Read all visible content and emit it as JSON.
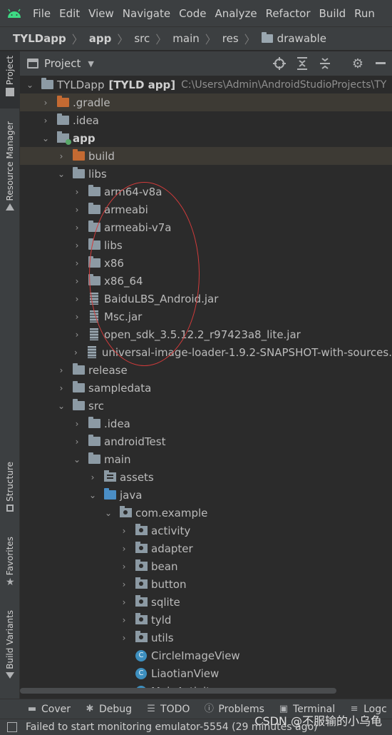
{
  "menu": {
    "items": [
      "File",
      "Edit",
      "View",
      "Navigate",
      "Code",
      "Analyze",
      "Refactor",
      "Build",
      "Run"
    ]
  },
  "breadcrumb": {
    "items": [
      "TYLDapp",
      "app",
      "src",
      "main",
      "res",
      "drawable"
    ]
  },
  "tool_window": {
    "title": "Project"
  },
  "left_tabs": {
    "project": "Project",
    "resource_manager": "Resource Manager",
    "structure": "Structure",
    "favorites": "Favorites",
    "build_variants": "Build Variants"
  },
  "tree": {
    "root_name": "TYLDapp",
    "root_module": "[TYLD app]",
    "root_path": "C:\\Users\\Admin\\AndroidStudioProjects\\TY",
    "gradle": ".gradle",
    "idea": ".idea",
    "app": "app",
    "build": "build",
    "libs": "libs",
    "libs_children": [
      "arm64-v8a",
      "armeabi",
      "armeabi-v7a",
      "libs",
      "x86",
      "x86_64"
    ],
    "jars": [
      "BaiduLBS_Android.jar",
      "Msc.jar",
      "open_sdk_3.5.12.2_r97423a8_lite.jar",
      "universal-image-loader-1.9.2-SNAPSHOT-with-sources."
    ],
    "release": "release",
    "sampledata": "sampledata",
    "src": "src",
    "src_idea": ".idea",
    "android_test": "androidTest",
    "main": "main",
    "assets": "assets",
    "java": "java",
    "com_example": "com.example",
    "packages": [
      "activity",
      "adapter",
      "bean",
      "button",
      "sqlite",
      "tyld",
      "utils"
    ],
    "classes": [
      "CircleImageView",
      "LiaotianView",
      "MainActivity"
    ]
  },
  "bottom_tools": {
    "cover": "Cover",
    "debug": "Debug",
    "todo": "TODO",
    "problems": "Problems",
    "terminal": "Terminal",
    "logcat": "Logc"
  },
  "status": {
    "message": "Failed to start monitoring emulator-5554 (29 minutes ago)"
  },
  "watermark": "CSDN @不服输的小乌龟",
  "colors": {
    "background": "#2b2b2b",
    "panel": "#3c3f41",
    "annotation_ellipse": "#d23b3b",
    "excluded_folder": "#c46a32",
    "source_folder": "#4a8ec6"
  }
}
